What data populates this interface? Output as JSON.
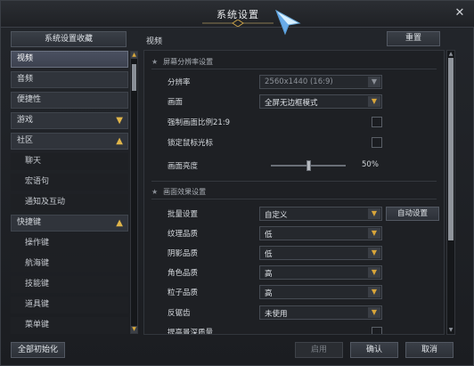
{
  "window": {
    "title": "系统设置"
  },
  "sidebar": {
    "favorites_label": "系统设置收藏",
    "items": [
      {
        "label": "视频",
        "active": true
      },
      {
        "label": "音频"
      },
      {
        "label": "便捷性"
      },
      {
        "label": "游戏",
        "chevron": "down"
      },
      {
        "label": "社区",
        "chevron": "up"
      },
      {
        "label": "聊天",
        "sub": true
      },
      {
        "label": "宏语句",
        "sub": true
      },
      {
        "label": "通知及互动",
        "sub": true
      },
      {
        "label": "快捷键",
        "chevron": "up"
      },
      {
        "label": "操作键",
        "sub": true
      },
      {
        "label": "航海键",
        "sub": true
      },
      {
        "label": "技能键",
        "sub": true
      },
      {
        "label": "道具键",
        "sub": true
      },
      {
        "label": "菜单键",
        "sub": true
      }
    ]
  },
  "main": {
    "section_title": "视频",
    "reset_label": "重置",
    "groups": {
      "screen": "屏幕分辨率设置",
      "effects": "画面效果设置"
    },
    "rows": {
      "resolution": {
        "label": "分辨率",
        "value": "2560x1440 (16:9)"
      },
      "display": {
        "label": "画面",
        "value": "全屏无边框模式"
      },
      "force_ratio": {
        "label": "强制画面比例21:9"
      },
      "lock_cursor": {
        "label": "锁定鼠标光标"
      },
      "brightness": {
        "label": "画面亮度",
        "value": "50%",
        "level": 0.5
      },
      "batch": {
        "label": "批量设置",
        "value": "自定义",
        "auto_label": "自动设置"
      },
      "texture": {
        "label": "纹理品质",
        "value": "低"
      },
      "shadow": {
        "label": "阴影品质",
        "value": "低"
      },
      "character": {
        "label": "角色品质",
        "value": "高"
      },
      "particle": {
        "label": "粒子品质",
        "value": "高"
      },
      "antialias": {
        "label": "反锯齿",
        "value": "未使用"
      },
      "depth": {
        "label": "提高景深质量"
      }
    }
  },
  "footer": {
    "reset_all": "全部初始化",
    "apply": "启用",
    "confirm": "确认",
    "cancel": "取消"
  },
  "colors": {
    "accent": "#d8a53a",
    "panel": "#1e2024",
    "active_tab": "#4a5060"
  }
}
